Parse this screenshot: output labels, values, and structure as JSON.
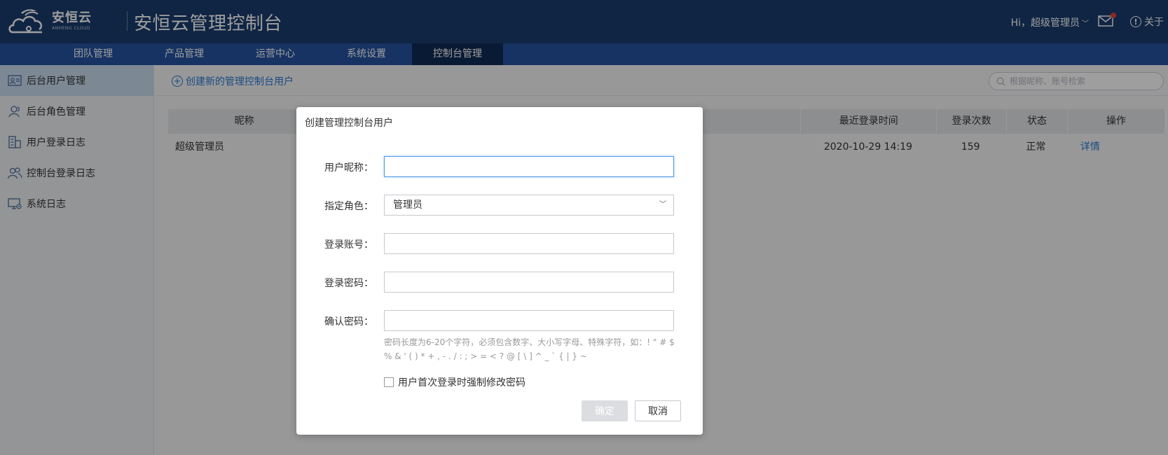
{
  "brand": {
    "logo_cn": "安恒云",
    "logo_en": "ANHENG CLOUD",
    "app_title": "安恒云管理控制台"
  },
  "header": {
    "user_label": "Hi，超级管理员",
    "about_label": "关于",
    "about_icon": "!"
  },
  "nav": {
    "items": [
      {
        "label": "团队管理"
      },
      {
        "label": "产品管理"
      },
      {
        "label": "运营中心"
      },
      {
        "label": "系统设置"
      },
      {
        "label": "控制台管理",
        "active": true
      }
    ]
  },
  "sidebar": {
    "items": [
      {
        "label": "后台用户管理",
        "icon": "id-card-icon",
        "active": true
      },
      {
        "label": "后台角色管理",
        "icon": "user-icon"
      },
      {
        "label": "用户登录日志",
        "icon": "building-log-icon"
      },
      {
        "label": "控制台登录日志",
        "icon": "users-icon"
      },
      {
        "label": "系统日志",
        "icon": "monitor-settings-icon"
      }
    ]
  },
  "toolbar": {
    "create_label": "创建新的管理控制台用户",
    "search_placeholder": "根据昵称、账号检索"
  },
  "table": {
    "headers": {
      "nickname": "昵称",
      "last_login": "最近登录时间",
      "login_count": "登录次数",
      "status": "状态",
      "actions": "操作"
    },
    "rows": [
      {
        "nickname": "超级管理员",
        "last_login": "2020-10-29 14:19",
        "login_count": "159",
        "status": "正常",
        "action": "详情"
      }
    ]
  },
  "modal": {
    "title": "创建管理控制台用户",
    "fields": {
      "nickname_label": "用户昵称：",
      "role_label": "指定角色：",
      "role_value": "管理员",
      "account_label": "登录账号：",
      "password_label": "登录密码：",
      "confirm_label": "确认密码："
    },
    "hint_line1": "密码长度为6-20个字符，必须包含数字、大小写字母、特殊字符，如：! \" # $",
    "hint_line2": "% & ' ( ) * + , - . / : ; > = < ? @ [ \\ ] ^ _ ` { | } ~",
    "force_change_label": "用户首次登录时强制修改密码",
    "ok_label": "确定",
    "cancel_label": "取消"
  },
  "colors": {
    "header_bg": "#1b3c6f",
    "nav_bg": "#2453a0",
    "nav_active": "#0f2a55",
    "link": "#2a7ad0",
    "sidebar_active": "#c8dcef"
  }
}
